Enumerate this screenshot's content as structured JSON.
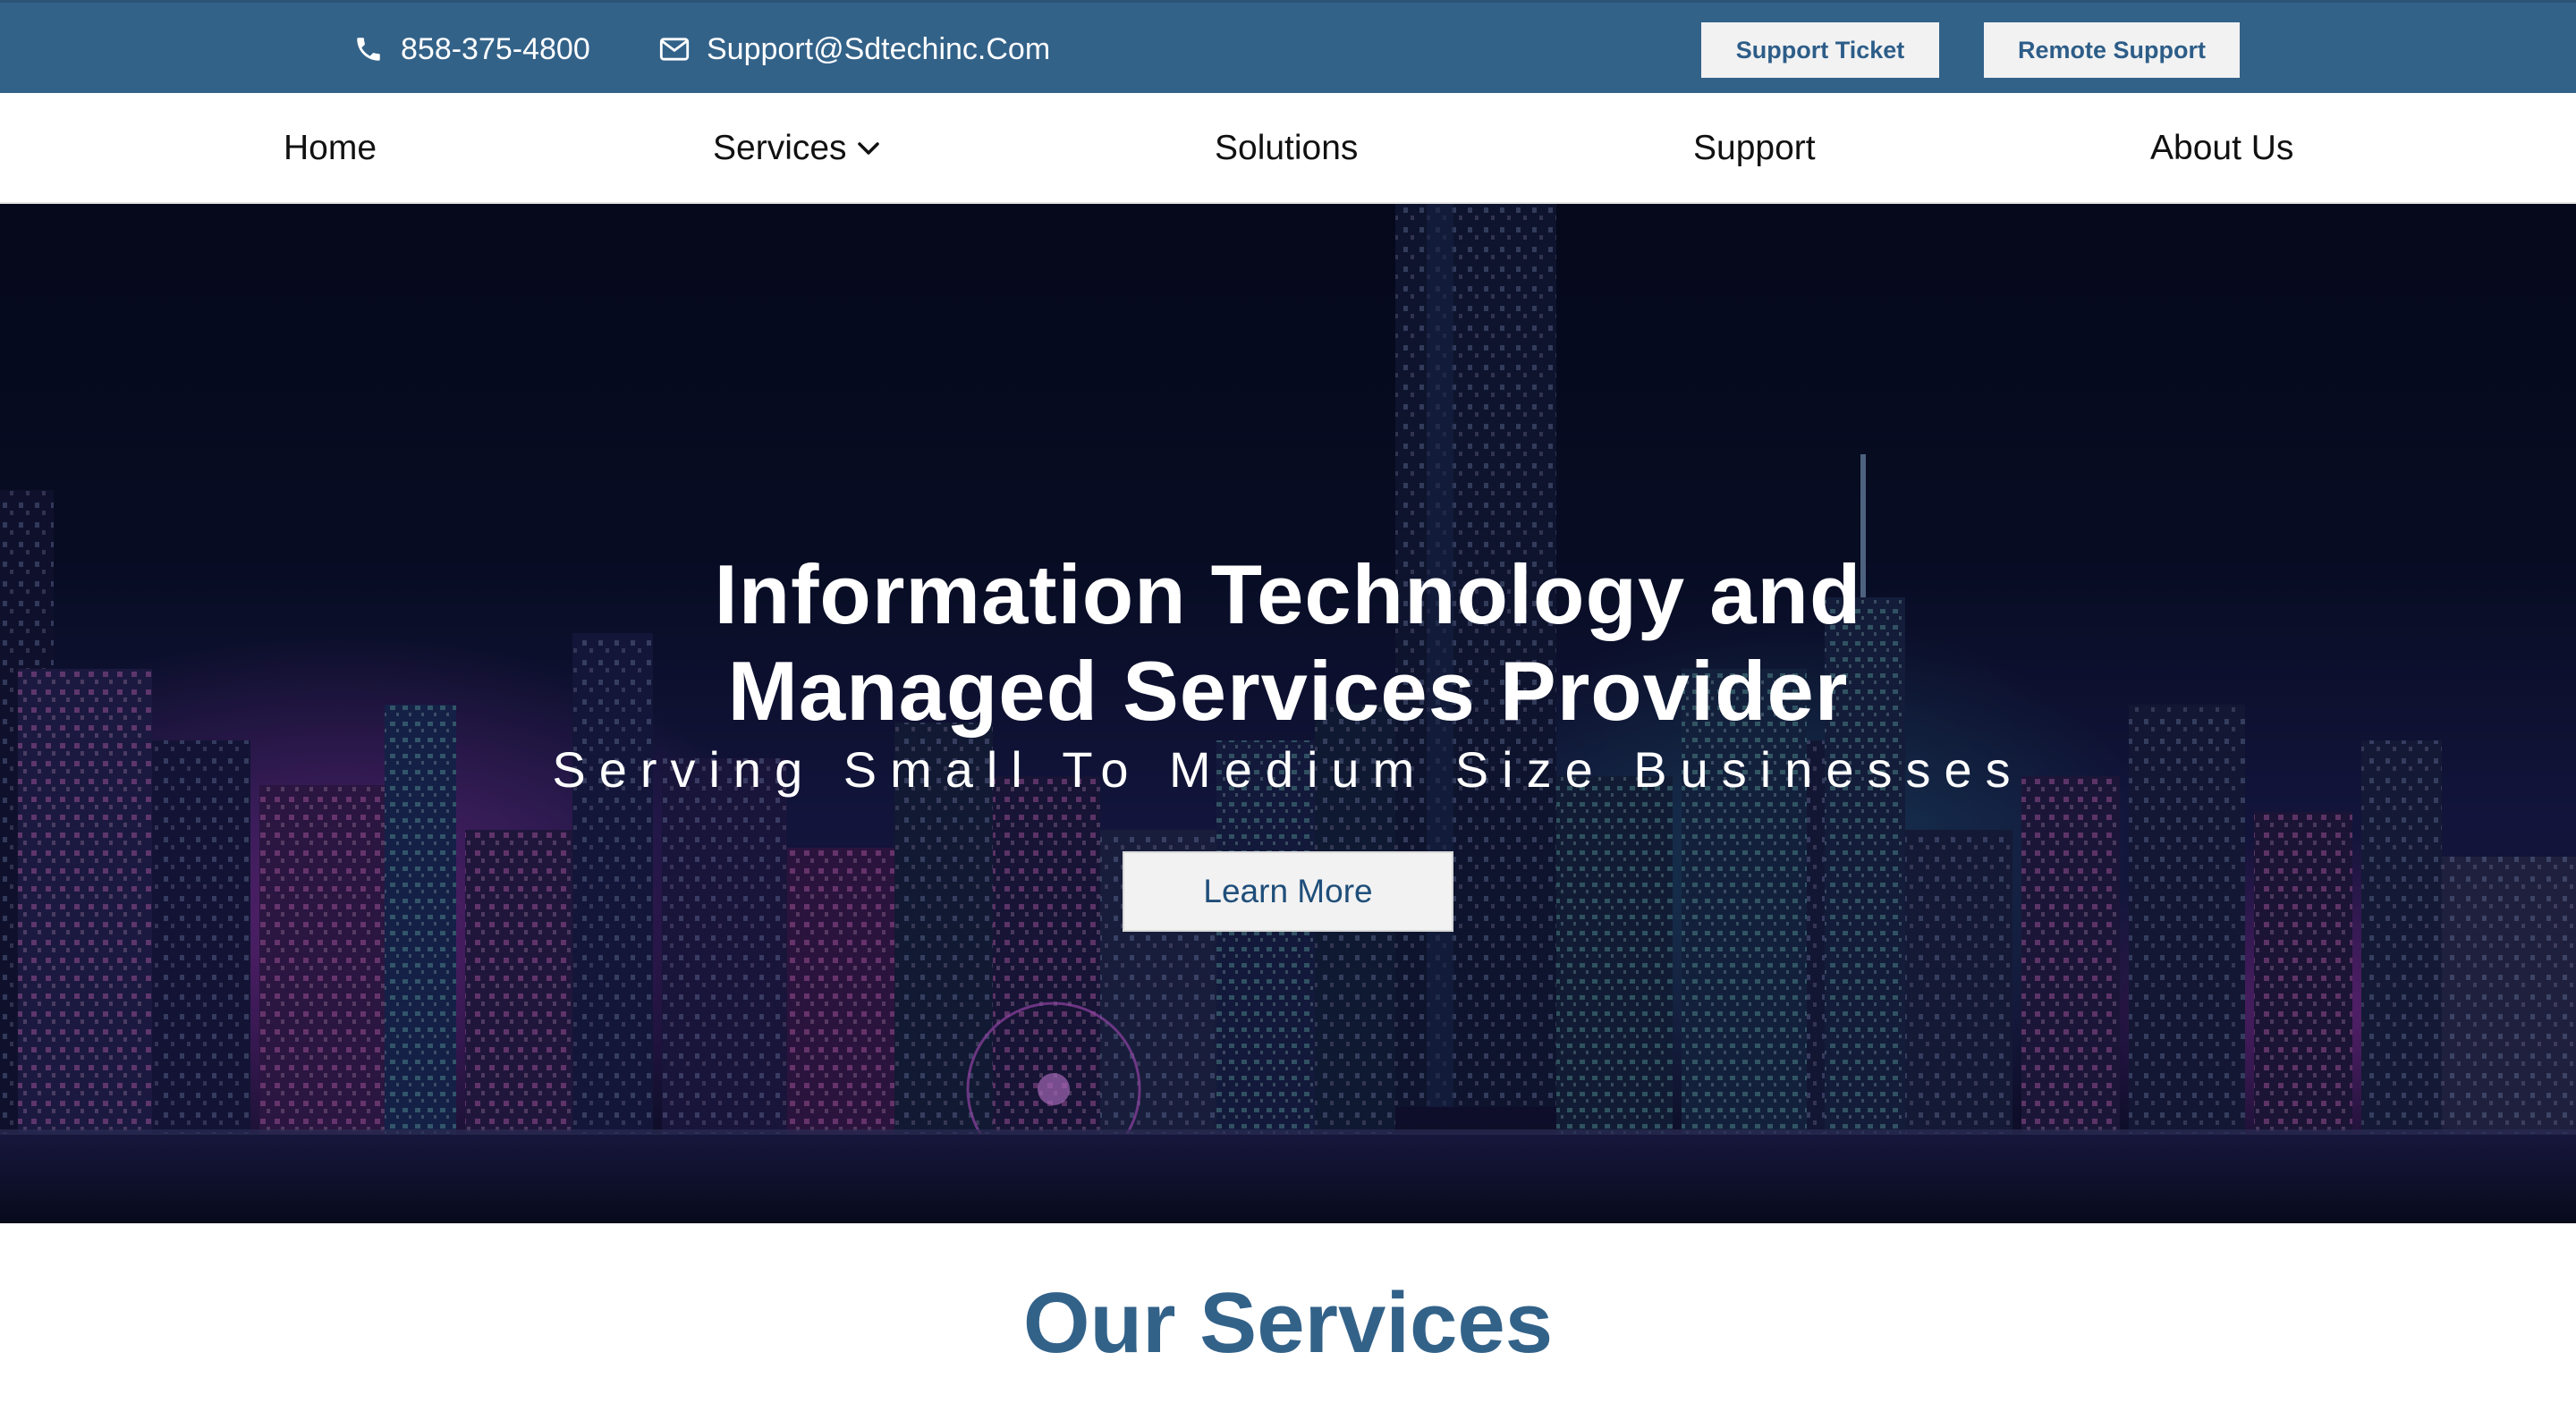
{
  "topbar": {
    "phone": "858-375-4800",
    "phone_icon": "phone-icon",
    "email": "Support@Sdtechinc.Com",
    "email_icon": "envelope-icon",
    "support_ticket_label": "Support Ticket",
    "remote_support_label": "Remote Support"
  },
  "nav": {
    "items": [
      {
        "label": "Home"
      },
      {
        "label": "Services",
        "icon": "chevron-down-icon"
      },
      {
        "label": "Solutions"
      },
      {
        "label": "Support"
      },
      {
        "label": "About Us"
      }
    ]
  },
  "hero": {
    "title_line1": "Information Technology and",
    "title_line2": "Managed Services Provider",
    "subtitle": "Serving Small To Medium Size Businesses",
    "cta_label": "Learn More"
  },
  "services": {
    "heading": "Our Services"
  },
  "colors": {
    "brand_blue": "#336289",
    "button_bg": "#f2f2f2",
    "button_text": "#2d5d88",
    "hero_text": "#ffffff"
  }
}
